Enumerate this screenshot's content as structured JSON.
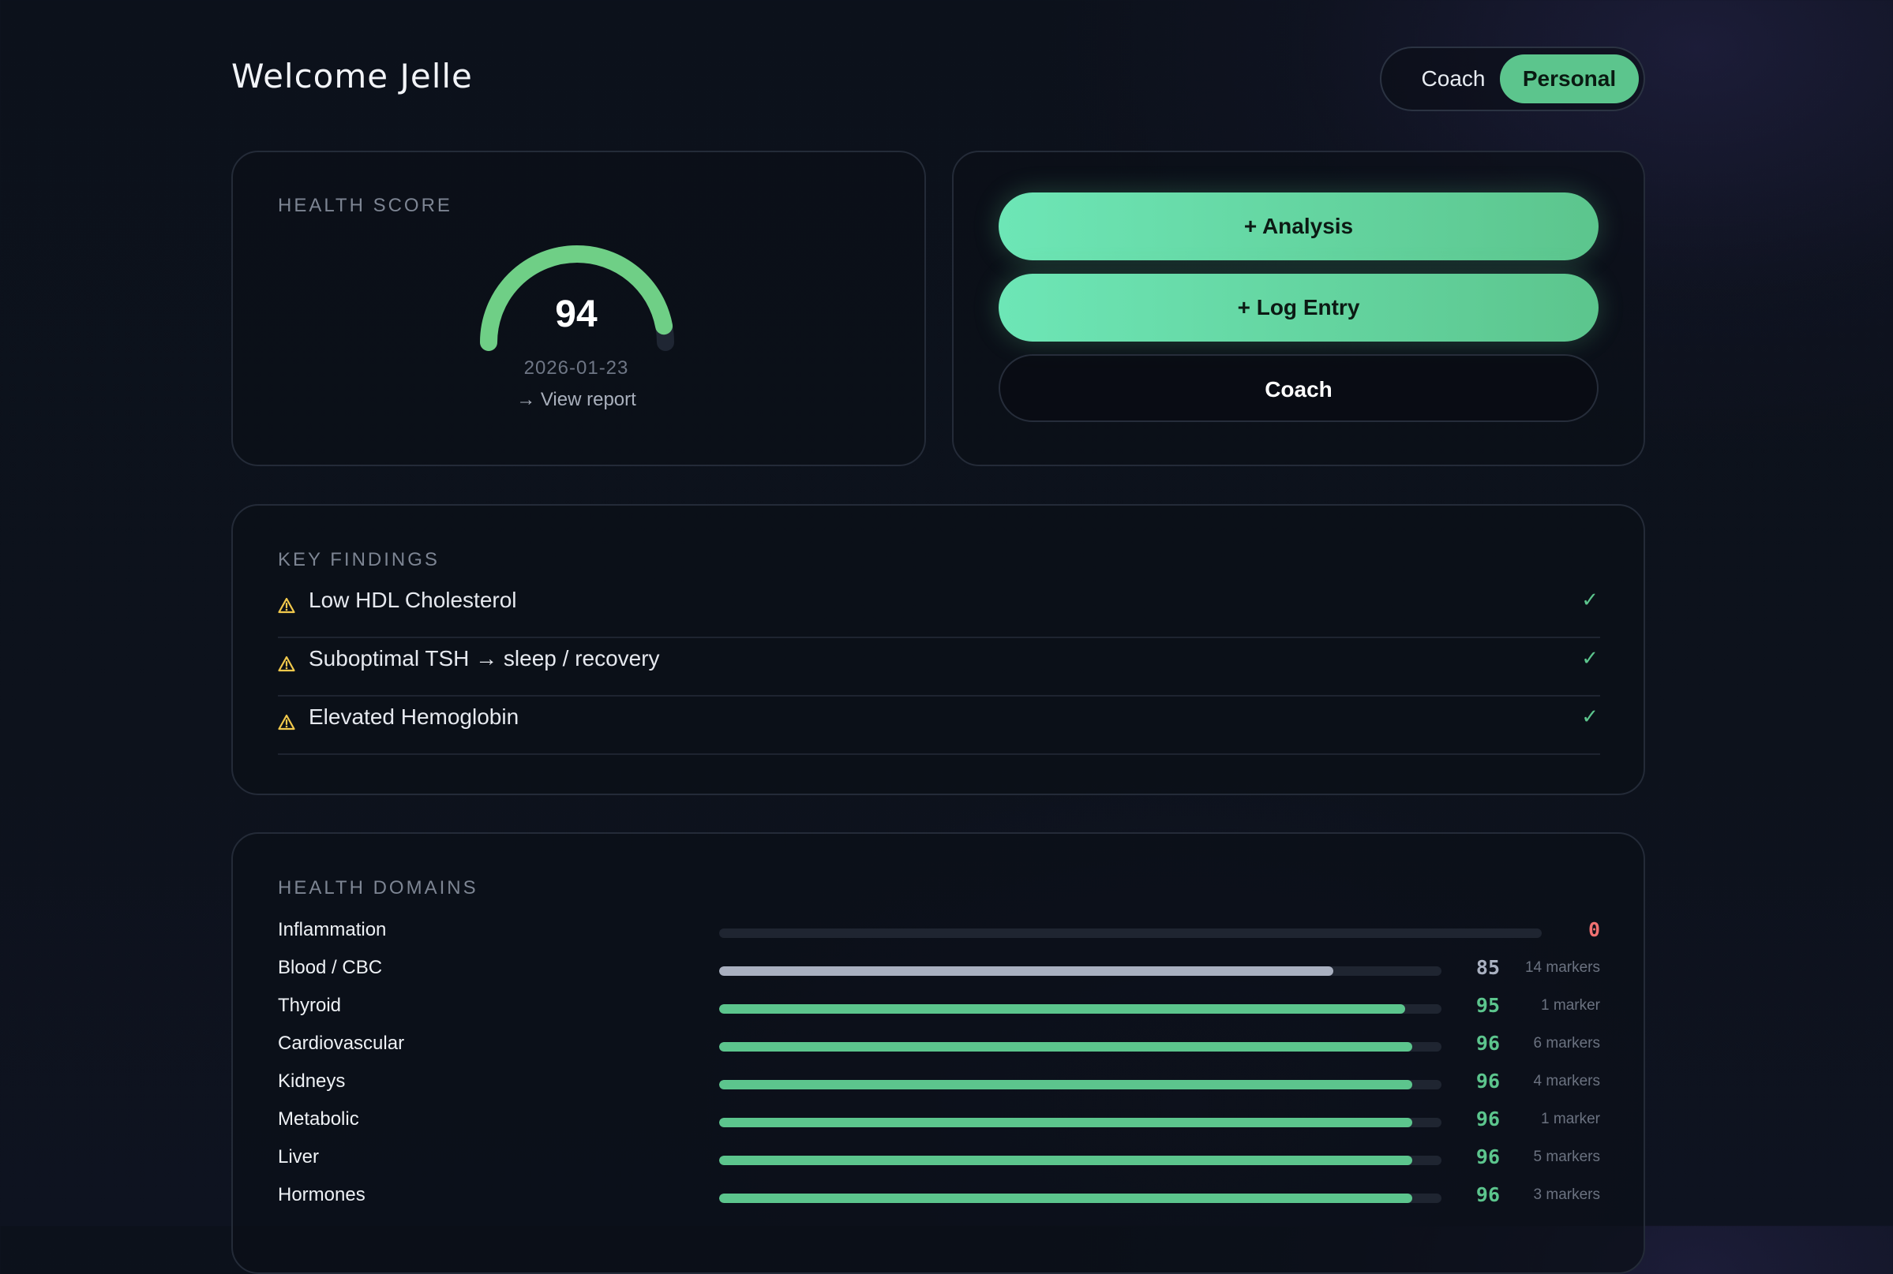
{
  "header": {
    "greeting": "Welcome Jelle"
  },
  "mode_toggle": {
    "options": [
      "Coach",
      "Personal"
    ],
    "selected": "Personal"
  },
  "health_score": {
    "label": "HEALTH SCORE",
    "value": "94",
    "value_fraction": 0.94,
    "date": "2026-01-23",
    "link": "→ View report",
    "gauge_color": "#6fcf86"
  },
  "actions": {
    "analysis": "+ Analysis",
    "log_entry": "+ Log Entry",
    "coach": "Coach"
  },
  "key_findings": {
    "label": "KEY FINDINGS",
    "items": [
      {
        "text": "Low HDL Cholesterol",
        "status_icon": "warning-icon",
        "check": "✓"
      },
      {
        "text": "Suboptimal TSH → sleep / recovery",
        "status_icon": "warning-icon",
        "check": "✓"
      },
      {
        "text": "Elevated Hemoglobin",
        "status_icon": "warning-icon",
        "check": "✓"
      }
    ]
  },
  "health_domains": {
    "label": "HEALTH DOMAINS",
    "items": [
      {
        "name": "Inflammation",
        "score": "0",
        "value": 0,
        "markers": "",
        "color": "#f07171"
      },
      {
        "name": "Blood / CBC",
        "score": "85",
        "value": 85,
        "markers": "14 markers",
        "color": "#a9b0c0"
      },
      {
        "name": "Thyroid",
        "score": "95",
        "value": 95,
        "markers": "1 marker",
        "color": "#5cc58d"
      },
      {
        "name": "Cardiovascular",
        "score": "96",
        "value": 96,
        "markers": "6 markers",
        "color": "#5cc58d"
      },
      {
        "name": "Kidneys",
        "score": "96",
        "value": 96,
        "markers": "4 markers",
        "color": "#5cc58d"
      },
      {
        "name": "Metabolic",
        "score": "96",
        "value": 96,
        "markers": "1 marker",
        "color": "#5cc58d"
      },
      {
        "name": "Liver",
        "score": "96",
        "value": 96,
        "markers": "5 markers",
        "color": "#5cc58d"
      },
      {
        "name": "Hormones",
        "score": "96",
        "value": 96,
        "markers": "3 markers",
        "color": "#5cc58d"
      }
    ]
  },
  "colors": {
    "accent": "#5cc58d",
    "warning": "#f2c94c",
    "negative": "#f07171"
  }
}
